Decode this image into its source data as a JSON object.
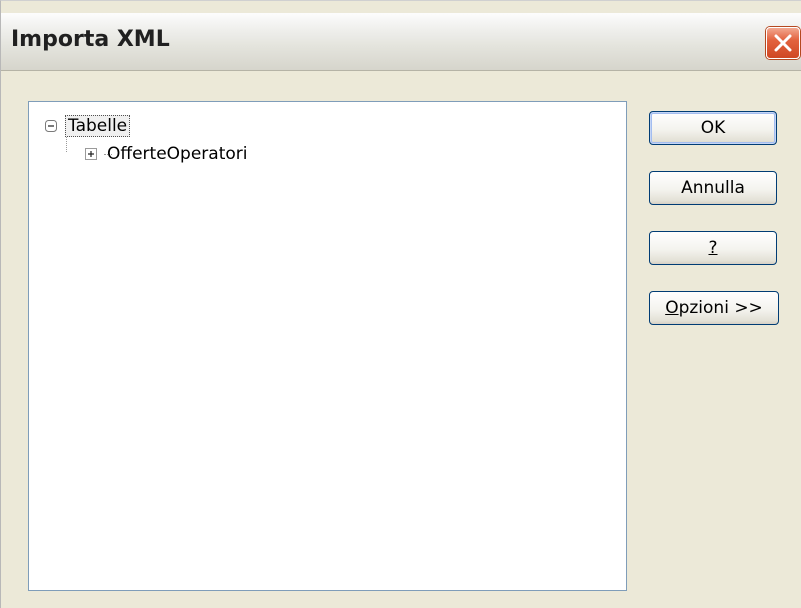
{
  "window": {
    "title": "Importa XML"
  },
  "tree": {
    "root": {
      "label": "Tabelle",
      "expanded": true,
      "children": [
        {
          "label": "OfferteOperatori",
          "expanded": false
        }
      ]
    }
  },
  "buttons": {
    "ok": "OK",
    "cancel": "Annulla",
    "help": "?",
    "options_mnemonic": "O",
    "options_rest": "pzioni >>"
  },
  "colors": {
    "dialog_bg": "#ece9d8",
    "button_border": "#003c74",
    "close_red": "#e3633f",
    "tree_border": "#7f9db9"
  },
  "icons": {
    "close": "close-icon",
    "collapse": "tree-collapse-icon",
    "expand": "tree-expand-icon"
  }
}
